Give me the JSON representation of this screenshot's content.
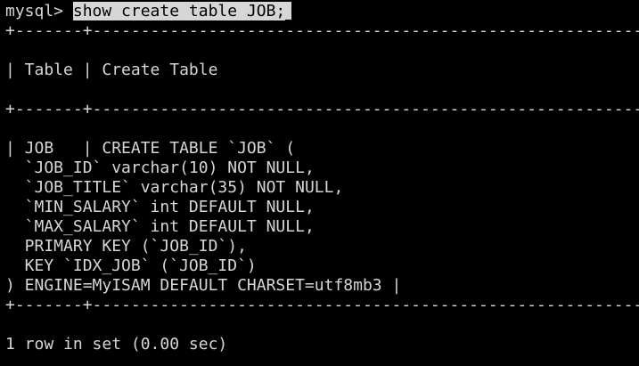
{
  "terminal": {
    "prompt": "mysql> ",
    "command": "show create table JOB;",
    "separator_top": "+-------+----------------------------------------------------------------------------------",
    "header_row": "| Table | Create Table",
    "separator_mid": "+-------+----------------------------------------------------------------------------------",
    "result_lines": [
      "| JOB   | CREATE TABLE `JOB` (",
      "  `JOB_ID` varchar(10) NOT NULL,",
      "  `JOB_TITLE` varchar(35) NOT NULL,",
      "  `MIN_SALARY` int DEFAULT NULL,",
      "  `MAX_SALARY` int DEFAULT NULL,",
      "  PRIMARY KEY (`JOB_ID`),",
      "  KEY `IDX_JOB` (`JOB_ID`)",
      ") ENGINE=MyISAM DEFAULT CHARSET=utf8mb3 |"
    ],
    "separator_bottom": "+-------+----------------------------------------------------------------------------------",
    "status": "1 row in set (0.00 sec)"
  },
  "colors": {
    "background": "#000000",
    "text": "#d6d6d6",
    "selection_background": "#d6d6d6",
    "selection_text": "#000000"
  }
}
